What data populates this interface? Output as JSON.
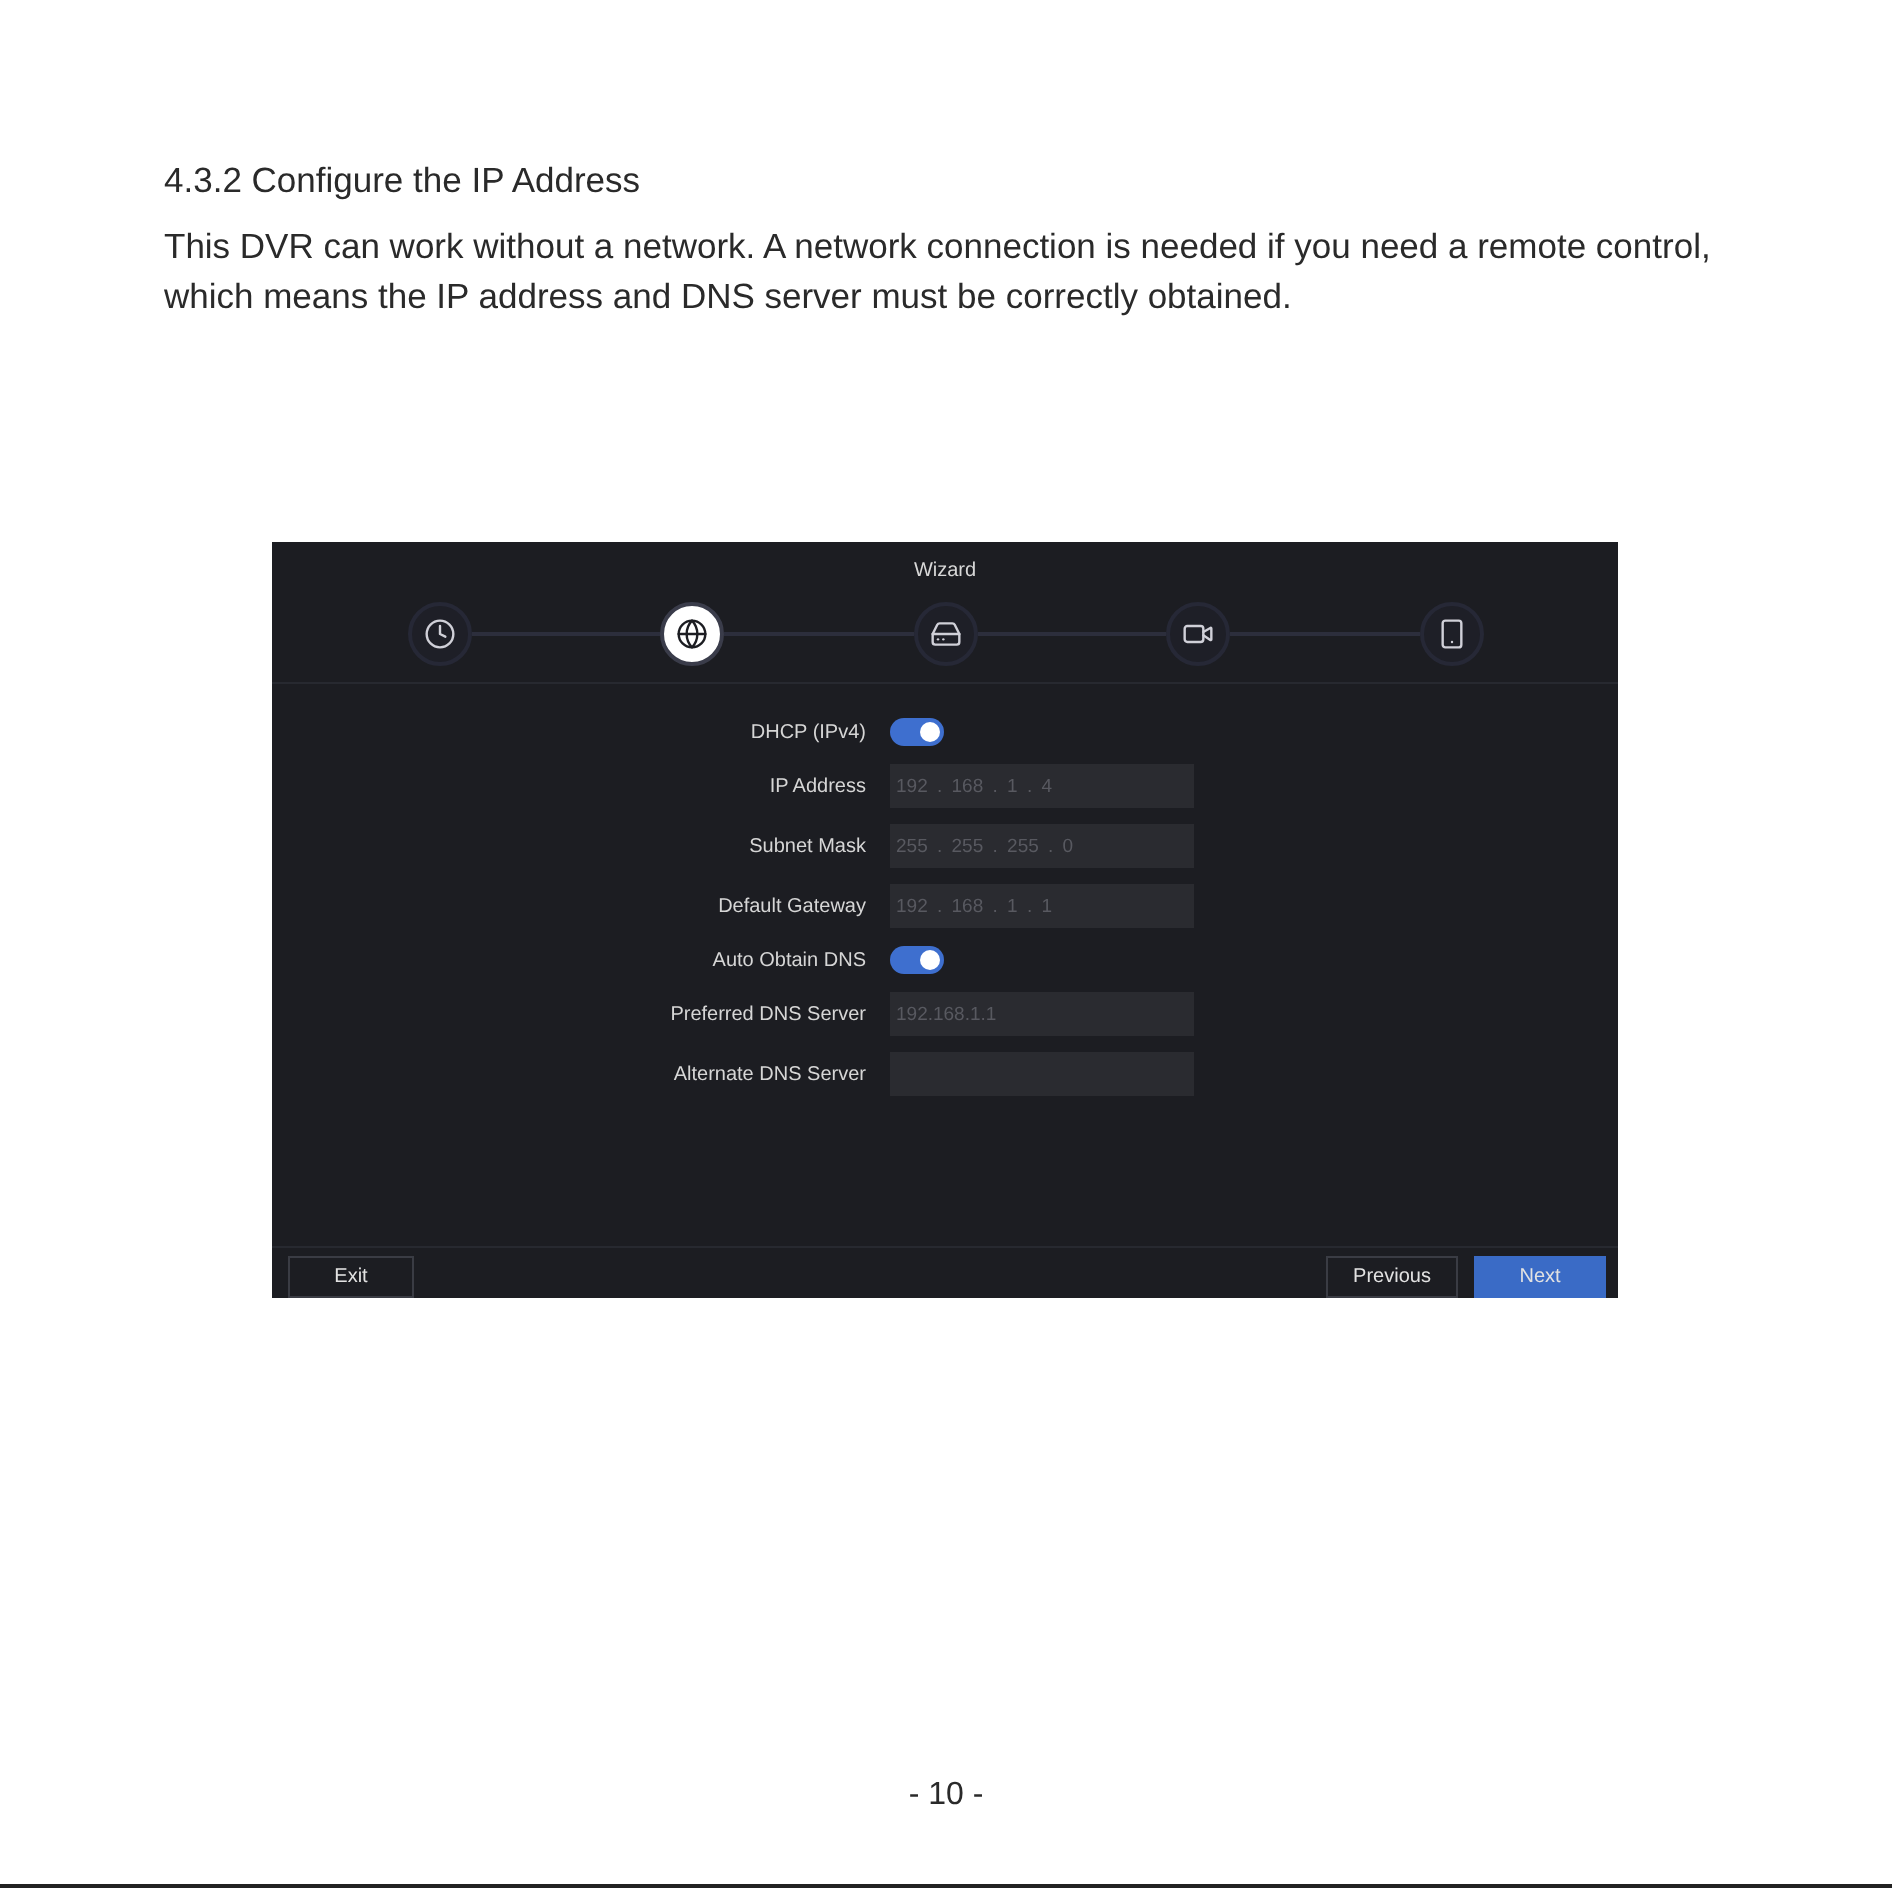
{
  "heading": "4.3.2 Configure the IP Address",
  "paragraph": "This DVR can work without a network. A network connection is needed if you need a remote control, which means the IP address and DNS server must be correctly obtained.",
  "wizard": {
    "title": "Wizard",
    "steps": [
      {
        "selected": false
      },
      {
        "selected": true
      },
      {
        "selected": false
      },
      {
        "selected": false
      },
      {
        "selected": false
      }
    ],
    "form": [
      {
        "kind": "toggle",
        "label": "DHCP (IPv4)",
        "on": true
      },
      {
        "kind": "field",
        "label": "IP Address",
        "value": "192 . 168 . 1 . 4",
        "disabled": true
      },
      {
        "kind": "field",
        "label": "Subnet Mask",
        "value": "255 . 255 . 255 . 0",
        "disabled": true
      },
      {
        "kind": "field",
        "label": "Default Gateway",
        "value": "192 . 168 . 1 . 1",
        "disabled": true
      },
      {
        "kind": "toggle",
        "label": "Auto Obtain DNS",
        "on": true
      },
      {
        "kind": "field",
        "label": "Preferred DNS Server",
        "value": "192.168.1.1",
        "disabled": true
      },
      {
        "kind": "field",
        "label": "Alternate DNS Server",
        "disabled": true
      }
    ],
    "exit_button": {
      "label": "Exit"
    },
    "nav_buttons": [
      {
        "label": "Previous",
        "primary": false
      },
      {
        "label": "Next",
        "primary": true
      }
    ]
  },
  "page_number": "- 10 -"
}
